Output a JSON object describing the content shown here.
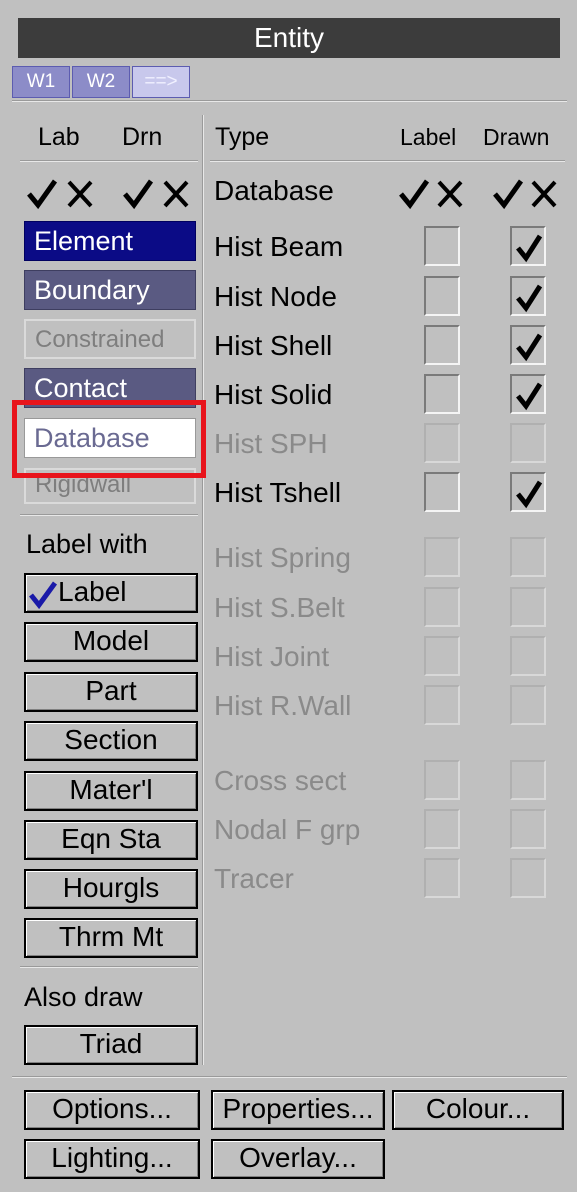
{
  "title": "Entity",
  "window_buttons": [
    "W1",
    "W2",
    "==>"
  ],
  "left_headers": {
    "lab": "Lab",
    "drn": "Drn"
  },
  "entity_buttons": [
    "Element",
    "Boundary",
    "Constrained",
    "Contact",
    "Database",
    "Rigidwall"
  ],
  "label_with_heading": "Label with",
  "label_with_buttons": [
    "Label",
    "Model",
    "Part",
    "Section",
    "Mater'l",
    "Eqn Sta",
    "Hourgls",
    "Thrm Mt"
  ],
  "also_draw_heading": "Also draw",
  "also_draw_buttons": [
    "Triad"
  ],
  "table_headers": {
    "type": "Type",
    "label": "Label",
    "drawn": "Drawn"
  },
  "header_row": {
    "name": "Database"
  },
  "rows": [
    {
      "name": "Hist Beam",
      "label": false,
      "drawn": true,
      "enabled": true
    },
    {
      "name": "Hist Node",
      "label": false,
      "drawn": true,
      "enabled": true
    },
    {
      "name": "Hist Shell",
      "label": false,
      "drawn": true,
      "enabled": true
    },
    {
      "name": "Hist Solid",
      "label": false,
      "drawn": true,
      "enabled": true
    },
    {
      "name": "Hist SPH",
      "label": false,
      "drawn": false,
      "enabled": false
    },
    {
      "name": "Hist Tshell",
      "label": false,
      "drawn": true,
      "enabled": true
    },
    {
      "name": "Hist Spring",
      "label": false,
      "drawn": false,
      "enabled": false
    },
    {
      "name": "Hist S.Belt",
      "label": false,
      "drawn": false,
      "enabled": false
    },
    {
      "name": "Hist Joint",
      "label": false,
      "drawn": false,
      "enabled": false
    },
    {
      "name": "Hist R.Wall",
      "label": false,
      "drawn": false,
      "enabled": false
    },
    {
      "name": "Cross sect",
      "label": false,
      "drawn": false,
      "enabled": false
    },
    {
      "name": "Nodal F grp",
      "label": false,
      "drawn": false,
      "enabled": false
    },
    {
      "name": "Tracer",
      "label": false,
      "drawn": false,
      "enabled": false
    }
  ],
  "bottom_buttons": [
    "Options...",
    "Properties...",
    "Colour...",
    "Lighting...",
    "Overlay..."
  ],
  "colors": {
    "titlebar": "#3c3c3c",
    "selected_entity": "#0b0b86",
    "highlight_box": "#e8141c"
  }
}
